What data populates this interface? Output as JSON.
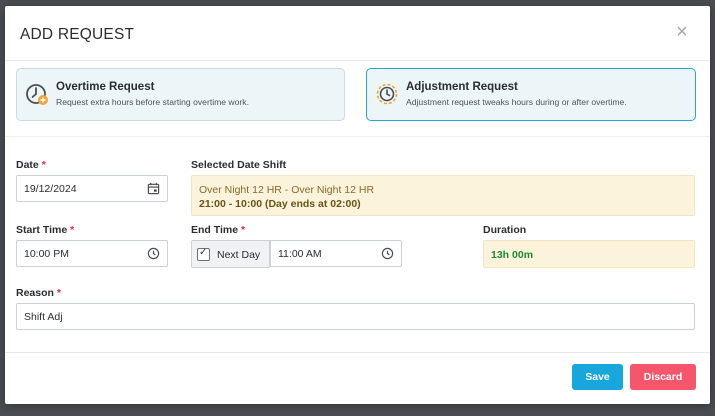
{
  "modal": {
    "title": "ADD REQUEST",
    "close_glyph": "×"
  },
  "request_types": [
    {
      "title": "Overtime Request",
      "subtitle": "Request extra hours before starting overtime work.",
      "icon": "clock-plus-icon",
      "selected": false
    },
    {
      "title": "Adjustment Request",
      "subtitle": "Adjustment request tweaks hours during or after overtime.",
      "icon": "clock-gear-icon",
      "selected": true
    }
  ],
  "fields": {
    "date": {
      "label": "Date",
      "required_mark": "*",
      "value": "19/12/2024",
      "icon": "calendar-icon"
    },
    "selected_shift": {
      "label": "Selected Date Shift",
      "line1": "Over Night 12 HR - Over Night 12 HR",
      "line2": "21:00 - 10:00 (Day ends at 02:00)"
    },
    "start_time": {
      "label": "Start Time",
      "required_mark": "*",
      "value": "10:00 PM",
      "icon": "clock-icon"
    },
    "end_time": {
      "label": "End Time",
      "required_mark": "*",
      "value": "11:00 AM",
      "icon": "clock-icon",
      "next_day_label": "Next Day",
      "next_day_checked": true,
      "check_glyph": "✓"
    },
    "duration": {
      "label": "Duration",
      "value": "13h 00m"
    },
    "reason": {
      "label": "Reason",
      "required_mark": "*",
      "value": "Shift Adj"
    }
  },
  "buttons": {
    "save": "Save",
    "discard": "Discard"
  },
  "colors": {
    "accent": "#17a7dc",
    "danger": "#f5566b",
    "required": "#e5283a",
    "duration_text": "#1e8a2f",
    "shift_bg": "#fcf3dd"
  }
}
